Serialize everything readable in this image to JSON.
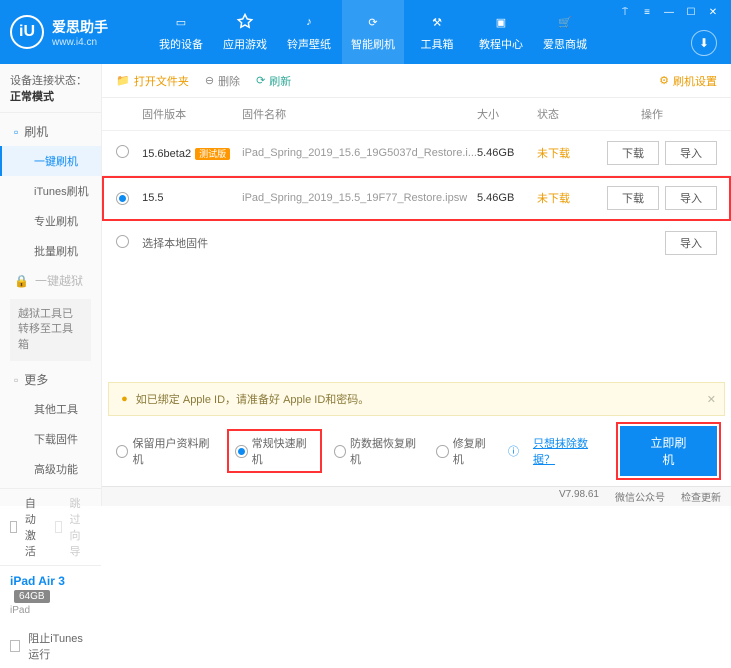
{
  "brand": {
    "name": "爱思助手",
    "url": "www.i4.cn",
    "logo_letter": "iU"
  },
  "titlebar": {
    "b1": "⍑",
    "b2": "≡",
    "b3": "—",
    "b4": "☐",
    "b5": "✕"
  },
  "nav": [
    {
      "label": "我的设备"
    },
    {
      "label": "应用游戏"
    },
    {
      "label": "铃声壁纸"
    },
    {
      "label": "智能刷机"
    },
    {
      "label": "工具箱"
    },
    {
      "label": "教程中心"
    },
    {
      "label": "爱思商城"
    }
  ],
  "conn": {
    "prefix": "设备连接状态：",
    "value": "正常模式"
  },
  "menu": {
    "g1": "刷机",
    "subs1": [
      "一键刷机",
      "iTunes刷机",
      "专业刷机",
      "批量刷机"
    ],
    "g2": "一键越狱",
    "note": "越狱工具已转移至工具箱",
    "g3": "更多",
    "subs3": [
      "其他工具",
      "下载固件",
      "高级功能"
    ]
  },
  "sb_footer": {
    "auto": "自动激活",
    "skip": "跳过向导",
    "block": "阻止iTunes运行"
  },
  "device": {
    "name": "iPad Air 3",
    "storage": "64GB",
    "type": "iPad"
  },
  "toolbar": {
    "open": "打开文件夹",
    "delete": "删除",
    "refresh": "刷新",
    "settings": "刷机设置"
  },
  "thead": {
    "ver": "固件版本",
    "name": "固件名称",
    "size": "大小",
    "status": "状态",
    "ops": "操作"
  },
  "rows": [
    {
      "ver": "15.6beta2",
      "tag": "测试版",
      "name": "iPad_Spring_2019_15.6_19G5037d_Restore.i...",
      "size": "5.46GB",
      "status": "未下载"
    },
    {
      "ver": "15.5",
      "tag": "",
      "name": "iPad_Spring_2019_15.5_19F77_Restore.ipsw",
      "size": "5.46GB",
      "status": "未下载"
    }
  ],
  "local": "选择本地固件",
  "btn": {
    "download": "下载",
    "import": "导入"
  },
  "warning": "如已绑定 Apple ID，请准备好 Apple ID和密码。",
  "opts": {
    "o1": "保留用户资料刷机",
    "o2": "常规快速刷机",
    "o3": "防数据恢复刷机",
    "o4": "修复刷机",
    "help": "ⓘ",
    "link": "只想抹除数据？"
  },
  "flash": "立即刷机",
  "footer": {
    "ver": "V7.98.61",
    "wx": "微信公众号",
    "upd": "检查更新"
  }
}
